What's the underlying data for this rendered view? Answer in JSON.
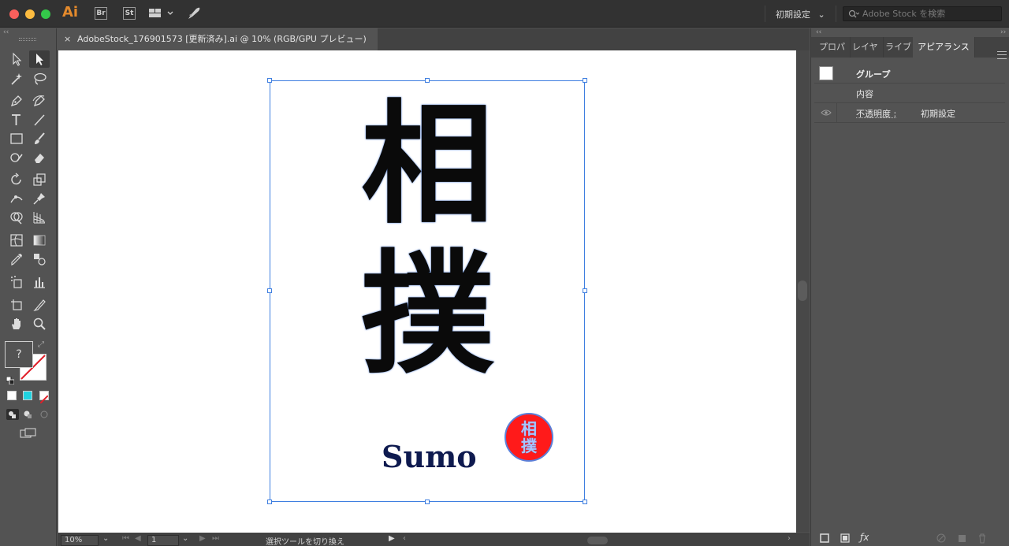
{
  "app": {
    "logo": "Ai",
    "bridge_label": "Br",
    "stock_label": "St",
    "workspace": "初期設定",
    "search_placeholder": "Adobe Stock を検索"
  },
  "document": {
    "tab_title": "AdobeStock_176901573 [更新済み].ai @ 10% (RGB/GPU プレビュー)",
    "close_glyph": "×"
  },
  "artwork": {
    "kanji_top": "相",
    "kanji_bottom": "撲",
    "caption": "Sumo",
    "seal_chars": [
      "相",
      "撲"
    ]
  },
  "toolbar": {
    "fill_placeholder": "?",
    "colors": {
      "gradient_swatch": "#1fd3e0",
      "selection": "#3f7fe0",
      "seal": "#ff1a1a"
    }
  },
  "status": {
    "zoom": "10%",
    "artboard_number": "1",
    "active_tool_hint": "選択ツールを切り換え"
  },
  "panel": {
    "tabs": [
      {
        "label": "プロパ",
        "active": false
      },
      {
        "label": "レイヤ",
        "active": false
      },
      {
        "label": "ライブ",
        "active": false
      },
      {
        "label": "アピアランス",
        "active": true
      }
    ],
    "appearance": {
      "group_label": "グループ",
      "contents_label": "内容",
      "opacity_label": "不透明度 :",
      "opacity_value": "初期設定"
    }
  }
}
